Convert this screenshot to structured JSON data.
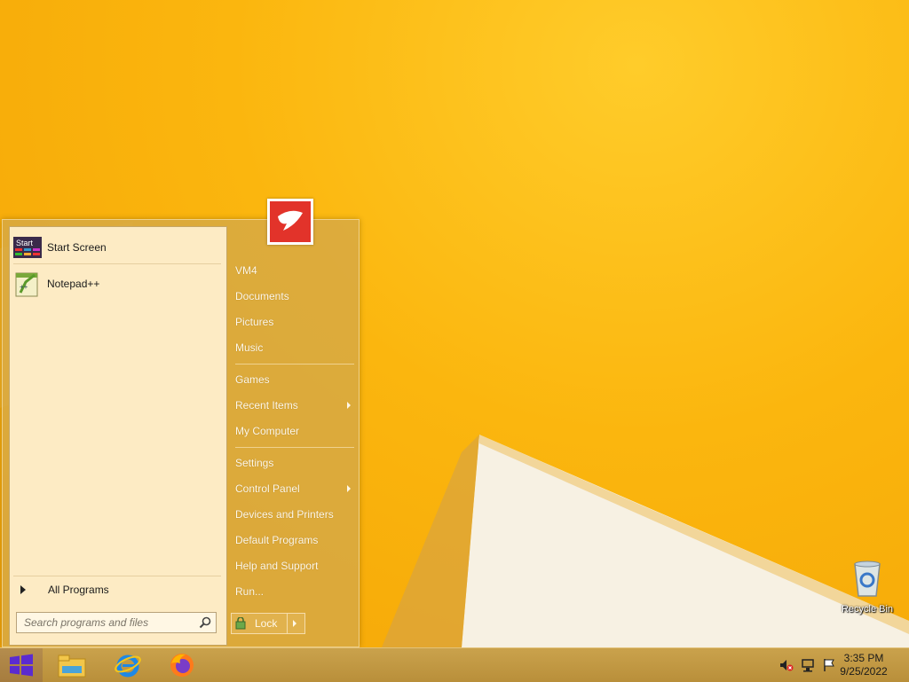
{
  "start_menu": {
    "pinned": [
      {
        "label": "Start Screen",
        "icon": "start-screen-icon"
      },
      {
        "label": "Notepad++",
        "icon": "notepadpp-icon"
      }
    ],
    "all_programs": "All Programs",
    "search_placeholder": "Search programs and files",
    "right_items": [
      {
        "label": "VM4",
        "submenu": false
      },
      {
        "label": "Documents",
        "submenu": false
      },
      {
        "label": "Pictures",
        "submenu": false
      },
      {
        "label": "Music",
        "submenu": false
      },
      {
        "label": "Games",
        "submenu": false
      },
      {
        "label": "Recent Items",
        "submenu": true
      },
      {
        "label": "My Computer",
        "submenu": false
      },
      {
        "label": "Settings",
        "submenu": false
      },
      {
        "label": "Control Panel",
        "submenu": true
      },
      {
        "label": "Devices and Printers",
        "submenu": false
      },
      {
        "label": "Default Programs",
        "submenu": false
      },
      {
        "label": "Help and Support",
        "submenu": false
      },
      {
        "label": "Run...",
        "submenu": false
      }
    ],
    "lock_label": "Lock",
    "start_tile_text": "Start"
  },
  "desktop": {
    "recycle_bin_label": "Recycle Bin"
  },
  "taskbar": {
    "apps": [
      "file-explorer-icon",
      "internet-explorer-icon",
      "firefox-icon"
    ],
    "clock_time": "3:35 PM",
    "clock_date": "9/25/2022"
  },
  "colors": {
    "wallpaper": "#f7b10a",
    "menu_left_pane": "#fdebc4",
    "user_tile_red": "#e2332a"
  }
}
